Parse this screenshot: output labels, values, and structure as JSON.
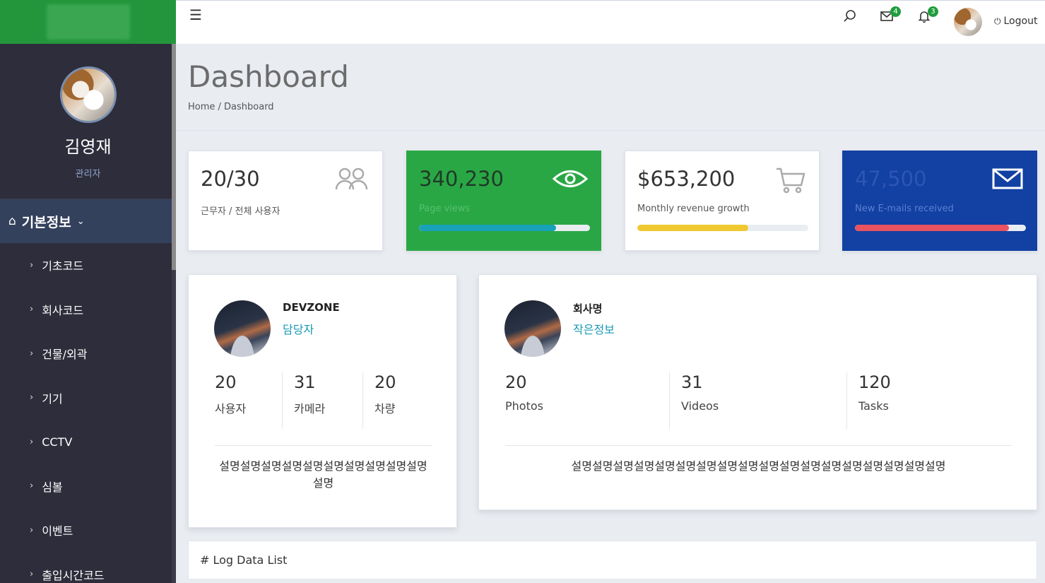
{
  "sidebar": {
    "user_name": "김영재",
    "user_role": "관리자",
    "menu_head": "기본정보",
    "items": [
      "기초코드",
      "회사코드",
      "건물/외곽",
      "기기",
      "CCTV",
      "심볼",
      "이벤트",
      "출입시간코드"
    ]
  },
  "topbar": {
    "mail_count": "4",
    "notification_count": "3",
    "logout_label": "Logout"
  },
  "header": {
    "title": "Dashboard",
    "breadcrumb": "Home / Dashboard"
  },
  "stats": [
    {
      "value": "20/30",
      "label": "근무자 / 전체 사용자",
      "icon": "users-icon"
    },
    {
      "value": "340,230",
      "label": "Page views",
      "icon": "eye-icon",
      "progress": 0.8,
      "bar_color": "#17a2b8"
    },
    {
      "value": "$653,200",
      "label": "Monthly revenue growth",
      "icon": "cart-icon",
      "progress": 0.65,
      "bar_color": "#f0c930"
    },
    {
      "value": "47,500",
      "label": "New E-mails received",
      "icon": "envelope-icon",
      "progress": 0.9,
      "bar_color": "#e9525f"
    }
  ],
  "cards": [
    {
      "name": "DEVZONE",
      "sub": "담당자",
      "stats": [
        {
          "n": "20",
          "t": "사용자"
        },
        {
          "n": "31",
          "t": "카메라"
        },
        {
          "n": "20",
          "t": "차량"
        }
      ],
      "desc": "설명설명설명설명설명설명설명설명설명설명설명"
    },
    {
      "name": "회사명",
      "sub": "작은정보",
      "stats": [
        {
          "n": "20",
          "t": "Photos"
        },
        {
          "n": "31",
          "t": "Videos"
        },
        {
          "n": "120",
          "t": "Tasks"
        }
      ],
      "desc": "설명설명설명설명설명설명설명설명설명설명설명설명설명설명설명설명설명설명"
    }
  ],
  "log_title": "# Log Data List",
  "colors": {
    "sidebar_bg": "#2d2d3b",
    "logo_green": "#23963c",
    "accent_teal": "#1a99b4"
  }
}
